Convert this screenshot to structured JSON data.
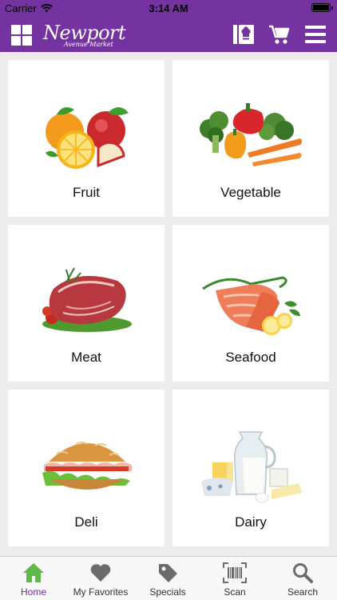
{
  "status_bar": {
    "carrier": "Carrier",
    "time": "3:14 AM"
  },
  "header": {
    "logo_main": "Newport",
    "logo_sub": "Avenue Market",
    "icons": [
      "grid-icon",
      "recipe-book-icon",
      "cart-icon",
      "menu-icon"
    ],
    "colors": {
      "bar": "#7433a0",
      "icon": "#ffffff"
    }
  },
  "categories": [
    {
      "label": "Fruit",
      "icon": "fruit-image"
    },
    {
      "label": "Vegetable",
      "icon": "vegetable-image"
    },
    {
      "label": "Meat",
      "icon": "meat-image"
    },
    {
      "label": "Seafood",
      "icon": "seafood-image"
    },
    {
      "label": "Deli",
      "icon": "deli-image"
    },
    {
      "label": "Dairy",
      "icon": "dairy-image"
    }
  ],
  "tabbar": {
    "active": "Home",
    "active_color": "#6e2f9c",
    "items": [
      {
        "label": "Home",
        "icon": "home-icon"
      },
      {
        "label": "My Favorites",
        "icon": "heart-icon"
      },
      {
        "label": "Specials",
        "icon": "tag-icon"
      },
      {
        "label": "Scan",
        "icon": "barcode-icon"
      },
      {
        "label": "Search",
        "icon": "search-icon"
      }
    ]
  }
}
